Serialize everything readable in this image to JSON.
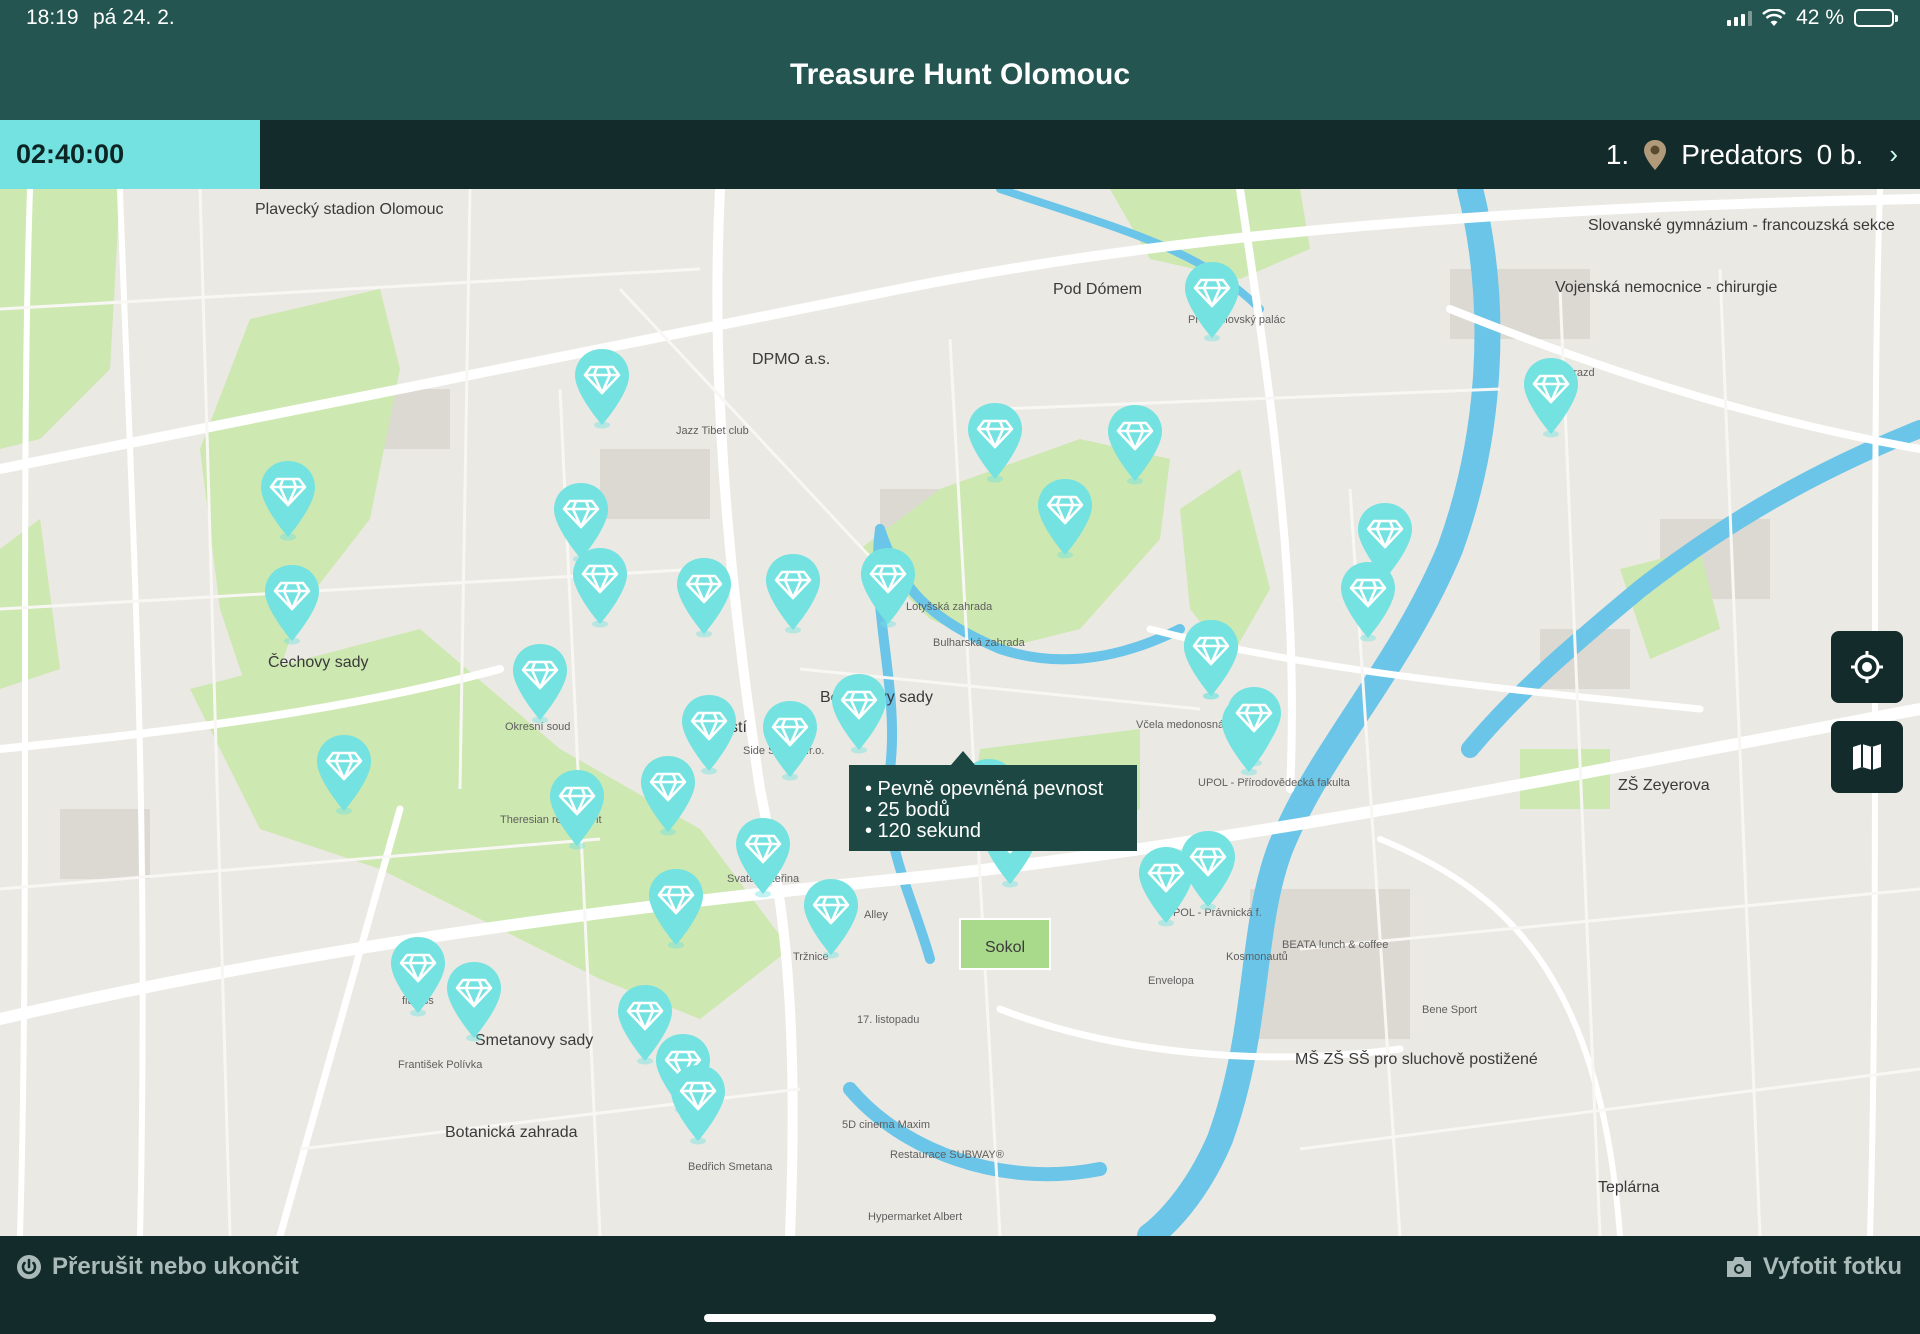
{
  "status_bar": {
    "time": "18:19",
    "date": "pá 24. 2.",
    "battery": "42 %",
    "battery_level": 0.42
  },
  "header": {
    "title": "Treasure Hunt Olomouc"
  },
  "timer": "02:40:00",
  "leaderboard": {
    "rank": "1.",
    "team": "Predators",
    "points": "0 b."
  },
  "tooltip": {
    "lines": [
      "• Pevně opevněná pevnost",
      "• 25 bodů",
      "• 120 sekund"
    ]
  },
  "map": {
    "labels": {
      "cechovy_sady": "Čechovy sady",
      "smetanovy_sady": "Smetanovy sady",
      "botanicka_zahrada": "Botanická zahrada",
      "bezrucovy_sady": "Bezručovy sady",
      "pod_domem": "Pod Dómem",
      "sokol": "Sokol",
      "teplarna": "Teplárna",
      "zs_zeyerova": "ZŠ Zeyerova",
      "dpmo": "DPMO a.s.",
      "stadion": "Plavecký stadion Olomouc",
      "gymnazium": "Slovanské gymnázium - francouzská sekce",
      "nemocnice": "Vojenská nemocnice - chirurgie",
      "ms_zs_ss": "MŠ ZŠ SŠ pro sluchově postižené",
      "namesti": "náměstí",
      "theresian": "Theresian restaurant",
      "bulharska": "Bulharská zahrada",
      "lotysska": "Lotyšská zahrada",
      "okresni_soud": "Okresní soud",
      "side_street": "Side Street s.r.o.",
      "svata_katerina": "Svatá Kateřina",
      "trznice": "Tržnice",
      "alley": "Alley",
      "kosmonautu": "Kosmonautů",
      "listopadu": "17. listopadu",
      "envelopa": "Envelopa",
      "vcela": "Včela medonosná",
      "upol_prav": "UPOL - Právnická f.",
      "upol_prir": "UPOL - Přírodovědecká fakulta",
      "cinema": "5D cinema Maxim",
      "subway": "Restaurace SUBWAY®",
      "hypermarket": "Hypermarket Albert",
      "beata": "BEATA lunch & coffee",
      "bene": "Bene Sport",
      "fitness": "fitness",
      "frantisek": "František Polívka",
      "bedrich": "Bedřich Smetana",
      "zzoo": "Přemyslovský palác",
      "jazz": "Jazz Tibet club",
      "svaty_gorazd": "Svatý Gorazd"
    }
  },
  "actions": {
    "interrupt": "Přerušit nebo ukončit",
    "photo": "Vyfotit fotku"
  },
  "icons": {
    "pin": "diamond-pin-icon",
    "locate": "locate-icon",
    "map": "map-layers-icon",
    "power": "power-icon",
    "camera": "camera-icon",
    "team": "team-pin-icon"
  },
  "colors": {
    "accent": "#73e2e0",
    "header": "#255550",
    "bar": "#142b2b",
    "park": "#cde8b0",
    "water": "#6ac5e8"
  }
}
